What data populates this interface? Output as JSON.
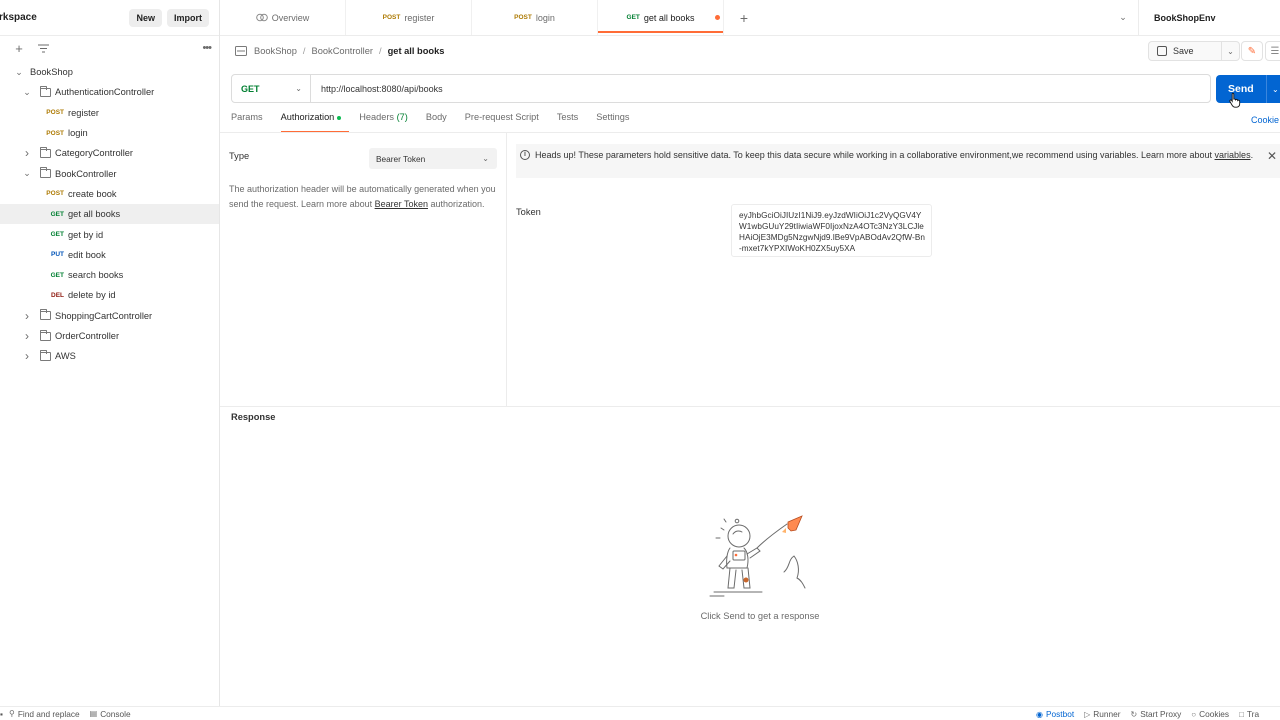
{
  "sidebar": {
    "workspace_title": "rkspace",
    "new_label": "New",
    "import_label": "Import",
    "more_label": "•••",
    "tree": [
      {
        "kind": "collection",
        "label": "BookShop",
        "expanded": true
      },
      {
        "kind": "folder",
        "label": "AuthenticationController",
        "expanded": true
      },
      {
        "kind": "request",
        "method": "POST",
        "label": "register"
      },
      {
        "kind": "request",
        "method": "POST",
        "label": "login"
      },
      {
        "kind": "folder",
        "label": "CategoryController",
        "expanded": false
      },
      {
        "kind": "folder",
        "label": "BookController",
        "expanded": true
      },
      {
        "kind": "request",
        "method": "POST",
        "label": "create book"
      },
      {
        "kind": "request",
        "method": "GET",
        "label": "get all books",
        "selected": true
      },
      {
        "kind": "request",
        "method": "GET",
        "label": "get by id"
      },
      {
        "kind": "request",
        "method": "PUT",
        "label": "edit book"
      },
      {
        "kind": "request",
        "method": "GET",
        "label": "search books"
      },
      {
        "kind": "request",
        "method": "DEL",
        "label": "delete by id"
      },
      {
        "kind": "folder",
        "label": "ShoppingCartController",
        "expanded": false
      },
      {
        "kind": "folder",
        "label": "OrderController",
        "expanded": false
      },
      {
        "kind": "folder",
        "label": "AWS",
        "expanded": false
      }
    ]
  },
  "tabs": {
    "items": [
      {
        "method": "",
        "label": "Overview",
        "icon": "overview-icon"
      },
      {
        "method": "POST",
        "label": "register"
      },
      {
        "method": "POST",
        "label": "login"
      },
      {
        "method": "GET",
        "label": "get all books",
        "active": true,
        "unsaved": true
      }
    ],
    "add_label": "+",
    "environment": "BookShopEnv"
  },
  "breadcrumb": {
    "collection": "BookShop",
    "sep1": "/",
    "folder": "BookController",
    "sep2": "/",
    "current": "get all books",
    "save_label": "Save"
  },
  "request": {
    "method": "GET",
    "url": "http://localhost:8080/api/books",
    "send_label": "Send",
    "cookies_label": "Cookie",
    "tabs": {
      "params": "Params",
      "authorization": "Authorization",
      "headers": "Headers",
      "headers_count": "(7)",
      "body": "Body",
      "prerequest": "Pre-request Script",
      "tests": "Tests",
      "settings": "Settings"
    }
  },
  "auth": {
    "type_label": "Type",
    "type_value": "Bearer Token",
    "description_pre": "The authorization header will be automatically generated when you send the request. Learn more about ",
    "description_link": "Bearer Token",
    "description_post": " authorization.",
    "alert_text": "Heads up! These parameters hold sensitive data. To keep this data secure while working in a collaborative environment,we recommend using variables. Learn more about ",
    "alert_link": "variables",
    "alert_end": ".",
    "token_label": "Token",
    "token_value": "eyJhbGciOiJIUzI1NiJ9.eyJzdWIiOiJ1c2VyQGV4YW1wbGUuY29tIiwiaWF0IjoxNzA4OTc3NzY3LCJleHAiOjE3MDg5NzgwNjd9.lBe9VpABOdAv2QfW-Bn-mxet7kYPXIWoKH0ZX5uy5XA"
  },
  "response": {
    "title": "Response",
    "hint": "Click Send to get a response"
  },
  "statusbar": {
    "find_replace": "Find and replace",
    "console": "Console",
    "postbot": "Postbot",
    "runner": "Runner",
    "start_proxy": "Start Proxy",
    "cookies": "Cookies",
    "trash": "Tra"
  },
  "colors": {
    "accent": "#ff6c37",
    "send": "#0265d2",
    "get": "#007f31",
    "post": "#ad7a03",
    "put": "#0053b8",
    "del": "#8e1a10"
  }
}
